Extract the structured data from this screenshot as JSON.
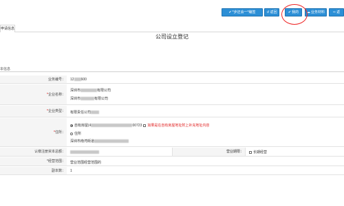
{
  "toolbar": {
    "btn_next": "*步还会一*编签",
    "btn_back": "返回",
    "btn_confirm": "我的",
    "btn_save": "业务材料",
    "btn_extra": "返"
  },
  "tab": {
    "label": "申请信息"
  },
  "form": {
    "title": "公司设立登记",
    "section": "本信息",
    "rows": {
      "business_no": {
        "label": "业务编号：",
        "value_prefix": "12",
        "value_suffix": "600"
      },
      "company_name": {
        "label": "企业名称：",
        "line1_prefix": "深圳市",
        "line1_suffix": "有限公司",
        "line2_prefix": "深圳市",
        "line2_suffix": "有限公司"
      },
      "company_type": {
        "label": "企业类型：",
        "value": "有限责任公司"
      },
      "address": {
        "label": "住所：",
        "opt1_prefix": "自有房屋(4",
        "opt1_suffix": "00723",
        "opt1_note": "如果是在自有房屋地址附上补充地址内容",
        "opt2": "住所",
        "opt2_addr": "深圳市南湾街道"
      },
      "capital": {
        "label": "认缴注册资本总额：",
        "right_label": "营业期限：",
        "right_value": "长期经营"
      },
      "scope": {
        "label": "*经营范围：",
        "value": "营业范围经营范围的"
      },
      "copies": {
        "label": "副本数：",
        "value": "1"
      }
    }
  }
}
